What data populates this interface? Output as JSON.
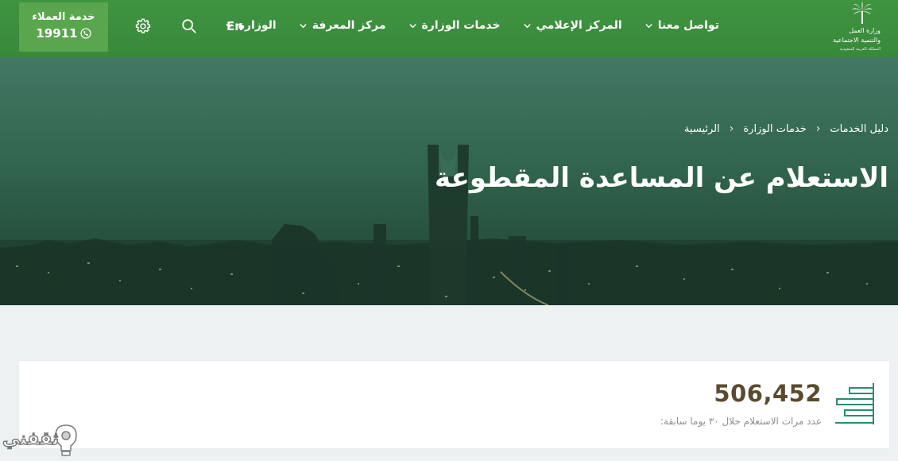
{
  "header": {
    "customer_service": {
      "title": "خدمة العملاء",
      "phone": "19911"
    },
    "language": "En",
    "nav": [
      {
        "label": "الوزارة"
      },
      {
        "label": "مركز المعرفة"
      },
      {
        "label": "خدمات الوزارة"
      },
      {
        "label": "المركز الإعلامي"
      },
      {
        "label": "تواصل معنا"
      }
    ],
    "logo": {
      "line1": "وزارة العمل",
      "line2": "والتنمية الاجتماعية",
      "line3": "المملكة العربية السعودية"
    },
    "icons": [
      "settings-icon",
      "search-icon",
      "phone-icon",
      "chevron-down-icon",
      "palm-logo-icon"
    ]
  },
  "hero": {
    "breadcrumb": [
      "الرئيسية",
      "خدمات الوزارة",
      "دليل الخدمات"
    ],
    "title": "الاستعلام عن المساعدة المقطوعة"
  },
  "stats": {
    "value": "506,452",
    "caption": "عدد مرات الاستعلام خلال ٣٠ يوما سابقة:",
    "icon": "bar-chart-icon"
  },
  "watermark": {
    "text": "ثقفني"
  },
  "colors": {
    "header_green": "#3f9440",
    "cs_box_green": "#5aa64f",
    "stat_value": "#5a4a2e",
    "icon_teal": "#2e8b6e"
  }
}
